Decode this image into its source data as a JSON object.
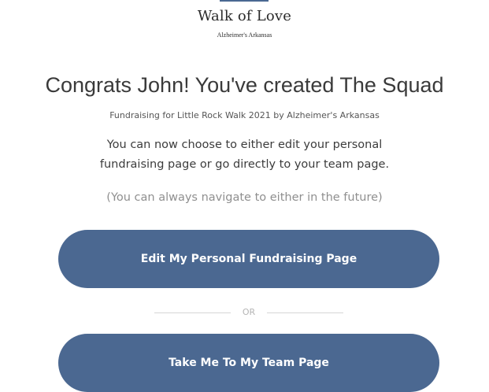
{
  "logo": {
    "title": "Walk of Love",
    "subtitle": "Alzheimer's Arkansas"
  },
  "headline": "Congrats John! You've created The Squad",
  "subtitle": "Fundraising for Little Rock Walk 2021 by Alzheimer's Arkansas",
  "body": {
    "line1": "You can now choose to either edit your personal",
    "line2": "fundraising page or go directly to your team page."
  },
  "note": "(You can always navigate to either in the future)",
  "buttons": {
    "edit_label": "Edit My Personal Fundraising Page",
    "team_label": "Take Me To My Team Page"
  },
  "divider": {
    "label": "OR"
  },
  "colors": {
    "button_bg": "#4b6891",
    "button_text": "#ffffff",
    "heading_text": "#3a3a3a",
    "muted_text": "#8f8f8f"
  }
}
